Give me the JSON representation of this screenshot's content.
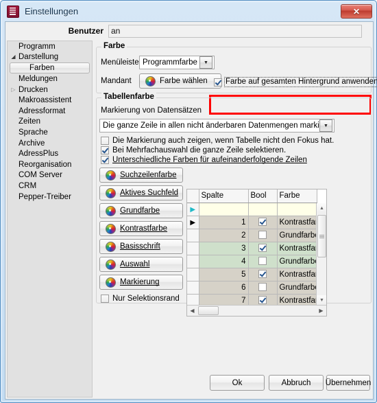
{
  "window": {
    "title": "Einstellungen",
    "app_icon": "document-stack-icon",
    "close_label": "✕"
  },
  "user": {
    "label": "Benutzer",
    "value": "an",
    "placeholder": ""
  },
  "sidebar": {
    "items": [
      {
        "label": "Programm",
        "level": 0,
        "arrow": "none",
        "selected": false
      },
      {
        "label": "Darstellung",
        "level": 0,
        "arrow": "expanded",
        "selected": false
      },
      {
        "label": "Farben",
        "level": 1,
        "arrow": "none",
        "selected": true
      },
      {
        "label": "Meldungen",
        "level": 0,
        "arrow": "none",
        "selected": false
      },
      {
        "label": "Drucken",
        "level": 0,
        "arrow": "collapsed",
        "selected": false
      },
      {
        "label": "Makroassistent",
        "level": 0,
        "arrow": "none",
        "selected": false
      },
      {
        "label": "Adressformat",
        "level": 0,
        "arrow": "none",
        "selected": false
      },
      {
        "label": "Zeiten",
        "level": 0,
        "arrow": "none",
        "selected": false
      },
      {
        "label": "Sprache",
        "level": 0,
        "arrow": "none",
        "selected": false
      },
      {
        "label": "Archive",
        "level": 0,
        "arrow": "none",
        "selected": false
      },
      {
        "label": "AdressPlus",
        "level": 0,
        "arrow": "none",
        "selected": false
      },
      {
        "label": "Reorganisation",
        "level": 0,
        "arrow": "none",
        "selected": false
      },
      {
        "label": "COM Server",
        "level": 0,
        "arrow": "none",
        "selected": false
      },
      {
        "label": "CRM",
        "level": 0,
        "arrow": "none",
        "selected": false
      },
      {
        "label": "Pepper-Treiber",
        "level": 0,
        "arrow": "none",
        "selected": false
      }
    ]
  },
  "farbe_group": {
    "title": "Farbe",
    "menu_label": "Menüleiste",
    "menu_value": "Programmfarbe",
    "mandant_label": "Mandant",
    "choose_color_button": "Farbe wählen",
    "choose_color_accesskey": "F",
    "apply_bg_checkbox": "Farbe auf gesamten Hintergrund anwenden",
    "apply_bg_checked": true,
    "highlight_color": "#ff0000"
  },
  "tabelle_group": {
    "title": "Tabellenfarbe",
    "marking_label": "Markierung von Datensätzen",
    "marking_value": "Die ganze Zeile in allen nicht änderbaren Datenmengen markieren",
    "checkboxes": [
      {
        "label": "Die Markierung auch zeigen, wenn Tabelle nicht den Fokus hat.",
        "checked": false
      },
      {
        "label": "Bei Mehrfachauswahl die ganze Zeile selektieren.",
        "checked": true
      },
      {
        "label": "Unterschiedliche  Farben für aufeinanderfolgende Zeilen",
        "checked": true,
        "accesskey": "U"
      }
    ],
    "color_buttons": [
      {
        "label": "Suchzeilenfarbe",
        "accesskey": "S"
      },
      {
        "label": "Aktives Suchfeld",
        "accesskey": "A"
      },
      {
        "label": "Grundfarbe",
        "accesskey": "G"
      },
      {
        "label": "Kontrastfarbe",
        "accesskey": "K"
      },
      {
        "label": "Basisschrift",
        "accesskey": "B"
      },
      {
        "label": "Auswahl",
        "accesskey": "u"
      },
      {
        "label": "Markierung",
        "accesskey": "M"
      }
    ],
    "selection_border_checkbox": {
      "label": "Nur Selektionsrand",
      "checked": false
    }
  },
  "grid": {
    "columns": [
      "",
      "Spalte",
      "Bool",
      "Farbe"
    ],
    "insert_row": {
      "indicator": "new-record-arrow",
      "spalte": "",
      "bool": null,
      "farbe": ""
    },
    "rows": [
      {
        "indicator": "current-row-arrow",
        "spalte": "1",
        "bool": true,
        "farbe": "Kontrastfarbe",
        "highlight": false
      },
      {
        "indicator": "",
        "spalte": "2",
        "bool": false,
        "farbe": "Grundfarbe",
        "highlight": false
      },
      {
        "indicator": "",
        "spalte": "3",
        "bool": true,
        "farbe": "Kontrastfarbe",
        "highlight": true
      },
      {
        "indicator": "",
        "spalte": "4",
        "bool": false,
        "farbe": "Grundfarbe",
        "highlight": true
      },
      {
        "indicator": "",
        "spalte": "5",
        "bool": true,
        "farbe": "Kontrastfarbe",
        "highlight": false
      },
      {
        "indicator": "",
        "spalte": "6",
        "bool": false,
        "farbe": "Grundfarbe",
        "highlight": false
      },
      {
        "indicator": "",
        "spalte": "7",
        "bool": true,
        "farbe": "Kontrastfarbe",
        "highlight": false
      }
    ]
  },
  "footer": {
    "ok": "Ok",
    "cancel": "Abbruch",
    "apply": "Übernehmen"
  }
}
